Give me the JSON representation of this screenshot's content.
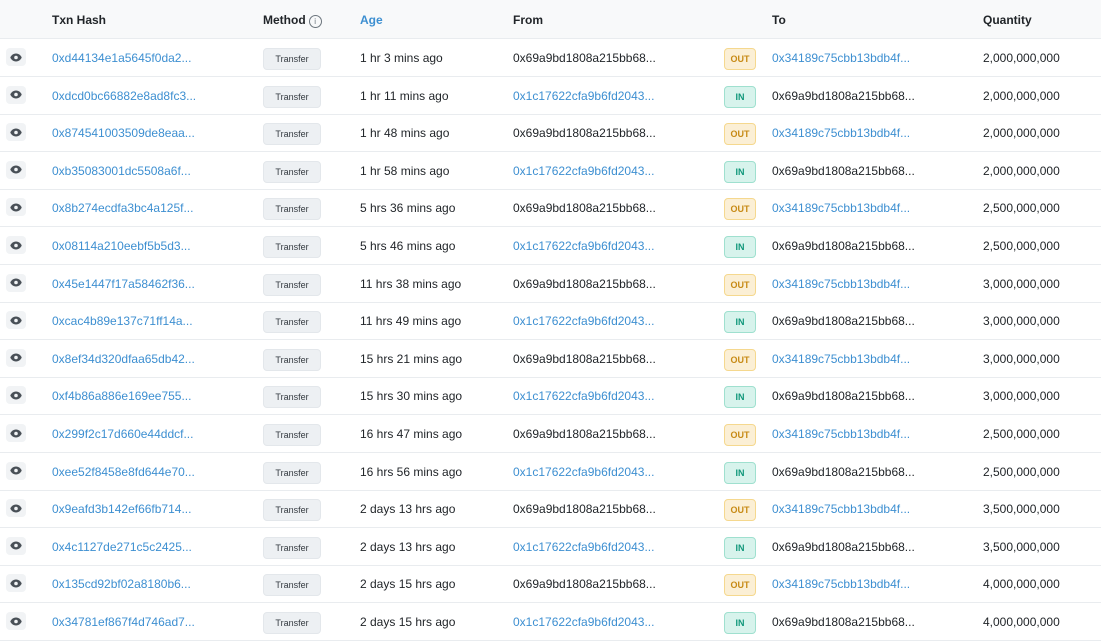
{
  "header": {
    "txn_hash": "Txn Hash",
    "method": "Method",
    "age": "Age",
    "from": "From",
    "to": "To",
    "quantity": "Quantity"
  },
  "rows": [
    {
      "hash": "0xd44134e1a5645f0da2...",
      "method": "Transfer",
      "age": "1 hr 3 mins ago",
      "from": "0x69a9bd1808a215bb68...",
      "dir": "OUT",
      "to": "0x34189c75cbb13bdb4f...",
      "qty": "2,000,000,000"
    },
    {
      "hash": "0xdcd0bc66882e8ad8fc3...",
      "method": "Transfer",
      "age": "1 hr 11 mins ago",
      "from": "0x1c17622cfa9b6fd2043...",
      "dir": "IN",
      "to": "0x69a9bd1808a215bb68...",
      "qty": "2,000,000,000"
    },
    {
      "hash": "0x874541003509de8eaa...",
      "method": "Transfer",
      "age": "1 hr 48 mins ago",
      "from": "0x69a9bd1808a215bb68...",
      "dir": "OUT",
      "to": "0x34189c75cbb13bdb4f...",
      "qty": "2,000,000,000"
    },
    {
      "hash": "0xb35083001dc5508a6f...",
      "method": "Transfer",
      "age": "1 hr 58 mins ago",
      "from": "0x1c17622cfa9b6fd2043...",
      "dir": "IN",
      "to": "0x69a9bd1808a215bb68...",
      "qty": "2,000,000,000"
    },
    {
      "hash": "0x8b274ecdfa3bc4a125f...",
      "method": "Transfer",
      "age": "5 hrs 36 mins ago",
      "from": "0x69a9bd1808a215bb68...",
      "dir": "OUT",
      "to": "0x34189c75cbb13bdb4f...",
      "qty": "2,500,000,000"
    },
    {
      "hash": "0x08114a210eebf5b5d3...",
      "method": "Transfer",
      "age": "5 hrs 46 mins ago",
      "from": "0x1c17622cfa9b6fd2043...",
      "dir": "IN",
      "to": "0x69a9bd1808a215bb68...",
      "qty": "2,500,000,000"
    },
    {
      "hash": "0x45e1447f17a58462f36...",
      "method": "Transfer",
      "age": "11 hrs 38 mins ago",
      "from": "0x69a9bd1808a215bb68...",
      "dir": "OUT",
      "to": "0x34189c75cbb13bdb4f...",
      "qty": "3,000,000,000"
    },
    {
      "hash": "0xcac4b89e137c71ff14a...",
      "method": "Transfer",
      "age": "11 hrs 49 mins ago",
      "from": "0x1c17622cfa9b6fd2043...",
      "dir": "IN",
      "to": "0x69a9bd1808a215bb68...",
      "qty": "3,000,000,000"
    },
    {
      "hash": "0x8ef34d320dfaa65db42...",
      "method": "Transfer",
      "age": "15 hrs 21 mins ago",
      "from": "0x69a9bd1808a215bb68...",
      "dir": "OUT",
      "to": "0x34189c75cbb13bdb4f...",
      "qty": "3,000,000,000"
    },
    {
      "hash": "0xf4b86a886e169ee755...",
      "method": "Transfer",
      "age": "15 hrs 30 mins ago",
      "from": "0x1c17622cfa9b6fd2043...",
      "dir": "IN",
      "to": "0x69a9bd1808a215bb68...",
      "qty": "3,000,000,000"
    },
    {
      "hash": "0x299f2c17d660e44ddcf...",
      "method": "Transfer",
      "age": "16 hrs 47 mins ago",
      "from": "0x69a9bd1808a215bb68...",
      "dir": "OUT",
      "to": "0x34189c75cbb13bdb4f...",
      "qty": "2,500,000,000"
    },
    {
      "hash": "0xee52f8458e8fd644e70...",
      "method": "Transfer",
      "age": "16 hrs 56 mins ago",
      "from": "0x1c17622cfa9b6fd2043...",
      "dir": "IN",
      "to": "0x69a9bd1808a215bb68...",
      "qty": "2,500,000,000"
    },
    {
      "hash": "0x9eafd3b142ef66fb714...",
      "method": "Transfer",
      "age": "2 days 13 hrs ago",
      "from": "0x69a9bd1808a215bb68...",
      "dir": "OUT",
      "to": "0x34189c75cbb13bdb4f...",
      "qty": "3,500,000,000"
    },
    {
      "hash": "0x4c1127de271c5c2425...",
      "method": "Transfer",
      "age": "2 days 13 hrs ago",
      "from": "0x1c17622cfa9b6fd2043...",
      "dir": "IN",
      "to": "0x69a9bd1808a215bb68...",
      "qty": "3,500,000,000"
    },
    {
      "hash": "0x135cd92bf02a8180b6...",
      "method": "Transfer",
      "age": "2 days 15 hrs ago",
      "from": "0x69a9bd1808a215bb68...",
      "dir": "OUT",
      "to": "0x34189c75cbb13bdb4f...",
      "qty": "4,000,000,000"
    },
    {
      "hash": "0x34781ef867f4d746ad7...",
      "method": "Transfer",
      "age": "2 days 15 hrs ago",
      "from": "0x1c17622cfa9b6fd2043...",
      "dir": "IN",
      "to": "0x69a9bd1808a215bb68...",
      "qty": "4,000,000,000"
    }
  ],
  "colors": {
    "link": "#3d8fd1",
    "out_badge_bg": "#fbefd5",
    "out_badge_text": "#c78a15",
    "in_badge_bg": "#d7f3ec",
    "in_badge_text": "#10977a"
  },
  "icons": {
    "view": "eye-icon",
    "info": "info-circle-icon"
  }
}
